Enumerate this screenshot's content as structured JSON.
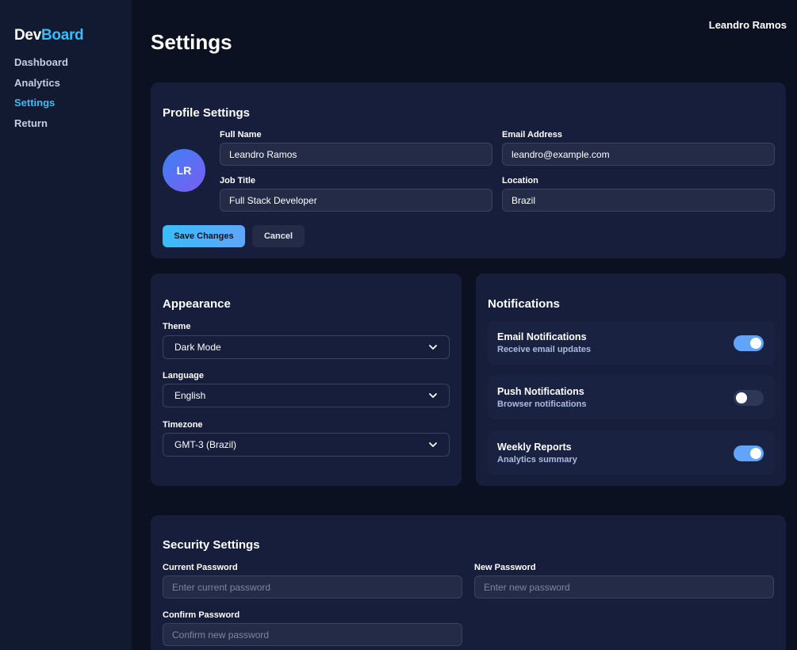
{
  "sidebar": {
    "logo_part1": "Dev",
    "logo_part2": "Board",
    "items": [
      {
        "label": "Dashboard"
      },
      {
        "label": "Analytics"
      },
      {
        "label": "Settings",
        "active": true
      },
      {
        "label": "Return"
      }
    ]
  },
  "header": {
    "page_title": "Settings",
    "user_name": "Leandro Ramos"
  },
  "profile": {
    "title": "Profile Settings",
    "avatar_initials": "LR",
    "full_name_label": "Full Name",
    "full_name_value": "Leandro Ramos",
    "email_label": "Email Address",
    "email_value": "leandro@example.com",
    "job_title_label": "Job Title",
    "job_title_value": "Full Stack Developer",
    "location_label": "Location",
    "location_value": "Brazil",
    "save_label": "Save Changes",
    "cancel_label": "Cancel"
  },
  "appearance": {
    "title": "Appearance",
    "theme_label": "Theme",
    "theme_value": "Dark Mode",
    "language_label": "Language",
    "language_value": "English",
    "timezone_label": "Timezone",
    "timezone_value": "GMT-3 (Brazil)"
  },
  "notifications": {
    "title": "Notifications",
    "items": [
      {
        "title": "Email Notifications",
        "subtitle": "Receive email updates",
        "enabled": true
      },
      {
        "title": "Push Notifications",
        "subtitle": "Browser notifications",
        "enabled": false
      },
      {
        "title": "Weekly Reports",
        "subtitle": "Analytics summary",
        "enabled": true
      }
    ]
  },
  "security": {
    "title": "Security Settings",
    "current_label": "Current Password",
    "current_placeholder": "Enter current password",
    "new_label": "New Password",
    "new_placeholder": "Enter new password",
    "confirm_label": "Confirm Password",
    "confirm_placeholder": "Confirm new password"
  },
  "colors": {
    "accent": "#38bdf8",
    "toggle_on": "#60a5fa",
    "card_bg": "#161e3c",
    "page_bg": "#0b1120",
    "sidebar_bg": "#111a30"
  }
}
